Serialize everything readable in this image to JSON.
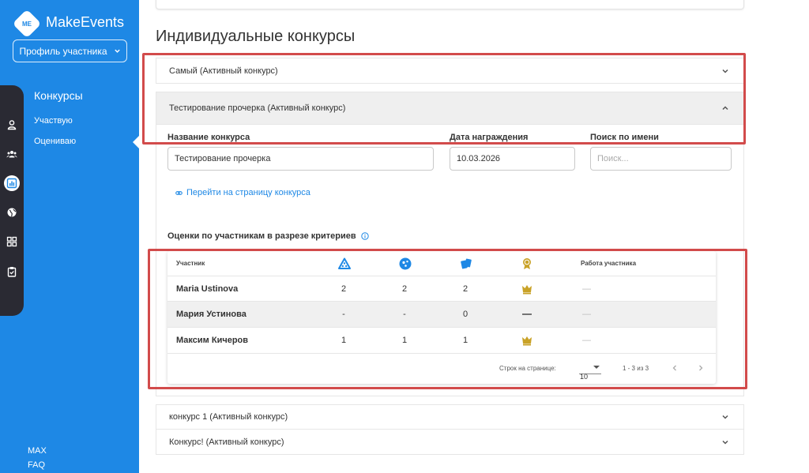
{
  "app": {
    "logo_badge": "ME",
    "name": "MakeEvents",
    "accent": "#1e88e5"
  },
  "sidebar": {
    "profile_button": "Профиль участника",
    "section_title": "Конкурсы",
    "links": [
      "Участвую",
      "Оцениваю"
    ],
    "bottom_links": [
      "MAX",
      "FAQ"
    ],
    "rail_icons": [
      "person-icon",
      "group-icon",
      "chart-icon",
      "globe-icon",
      "dashboard-icon",
      "clipboard-icon"
    ]
  },
  "main": {
    "title": "Индивидуальные конкурсы",
    "contests": [
      {
        "label": "Самый (Активный конкурс)",
        "expanded": false
      },
      {
        "label": "Тестирование прочерка (Активный конкурс)",
        "expanded": true
      },
      {
        "label": "конкурс 1 (Активный конкурс)",
        "expanded": false
      },
      {
        "label": "Конкурс! (Активный конкурс)",
        "expanded": false
      }
    ],
    "details": {
      "name_label": "Название конкурса",
      "name_value": "Тестирование прочерка",
      "date_label": "Дата награждения",
      "date_value": "10.03.2026",
      "search_label": "Поиск по имени",
      "search_placeholder": "Поиск...",
      "contest_link": "Перейти на страницу конкурса",
      "scores_title": "Оценки по участникам в разрезе критериев"
    },
    "table": {
      "headers": {
        "participant": "Участник",
        "work": "Работа участника"
      },
      "criteria_icons": [
        "triangle-dots-icon",
        "circle-dots-icon",
        "cards-icon",
        "award-icon"
      ],
      "rows": [
        {
          "name": "Maria Ustinova",
          "c1": "2",
          "c2": "2",
          "c3": "2",
          "award": "crown",
          "work": "—"
        },
        {
          "name": "Мария Устинова",
          "c1": "-",
          "c2": "-",
          "c3": "0",
          "award": "dash",
          "work": "—"
        },
        {
          "name": "Максим Кичеров",
          "c1": "1",
          "c2": "1",
          "c3": "1",
          "award": "crown",
          "work": "—"
        }
      ],
      "footer": {
        "rows_per_page_label": "Строк на странице:",
        "rows_per_page": "10",
        "range": "1 - 3 из 3"
      }
    }
  },
  "colors": {
    "highlight": "#d24b4b",
    "crown": "#c9a227",
    "sidebar_dark": "#2a2a33"
  }
}
